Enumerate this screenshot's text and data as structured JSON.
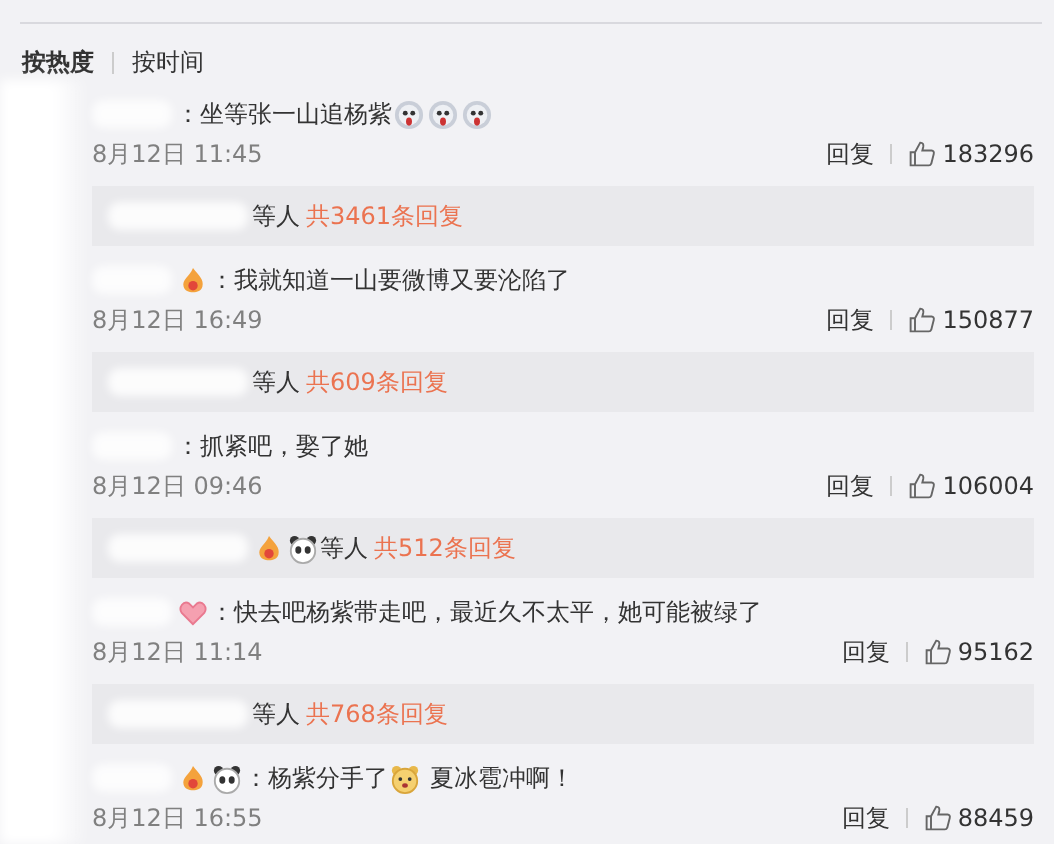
{
  "tabs": [
    {
      "label": "按热度",
      "selected": true
    },
    {
      "label": "按时间",
      "selected": false
    }
  ],
  "comments": [
    {
      "parts": [
        {
          "kind": "text",
          "text": "：坐等张一山追杨紫"
        },
        {
          "kind": "face"
        },
        {
          "kind": "face"
        },
        {
          "kind": "face"
        }
      ],
      "time": "8月12日 11:45",
      "reply_label": "回复",
      "likes": "183296",
      "replies": {
        "suffix": "等人",
        "count": "共3461条回复"
      }
    },
    {
      "parts": [
        {
          "kind": "badge"
        },
        {
          "kind": "text",
          "text": "：我就知道一山要微博又要沦陷了"
        }
      ],
      "time": "8月12日 16:49",
      "reply_label": "回复",
      "likes": "150877",
      "replies": {
        "suffix": "等人",
        "count": "共609条回复"
      }
    },
    {
      "parts": [
        {
          "kind": "text",
          "text": "：抓紧吧，娶了她"
        }
      ],
      "time": "8月12日 09:46",
      "reply_label": "回复",
      "likes": "106004",
      "replies": {
        "parts": [
          {
            "kind": "badge"
          },
          {
            "kind": "panda"
          }
        ],
        "suffix": "等人",
        "count": "共512条回复"
      }
    },
    {
      "parts": [
        {
          "kind": "heart"
        },
        {
          "kind": "text",
          "text": "：快去吧杨紫带走吧，最近久不太平，她可能被绿了"
        }
      ],
      "time": "8月12日 11:14",
      "reply_label": "回复",
      "likes": "95162",
      "replies": {
        "suffix": "等人",
        "count": "共768条回复"
      }
    },
    {
      "parts": [
        {
          "kind": "badge"
        },
        {
          "kind": "panda"
        },
        {
          "kind": "text",
          "text": "：杨紫分手了"
        },
        {
          "kind": "bear"
        },
        {
          "kind": "text",
          "text": " 夏冰雹冲啊！"
        }
      ],
      "time": "8月12日 16:55",
      "reply_label": "回复",
      "likes": "88459"
    }
  ]
}
